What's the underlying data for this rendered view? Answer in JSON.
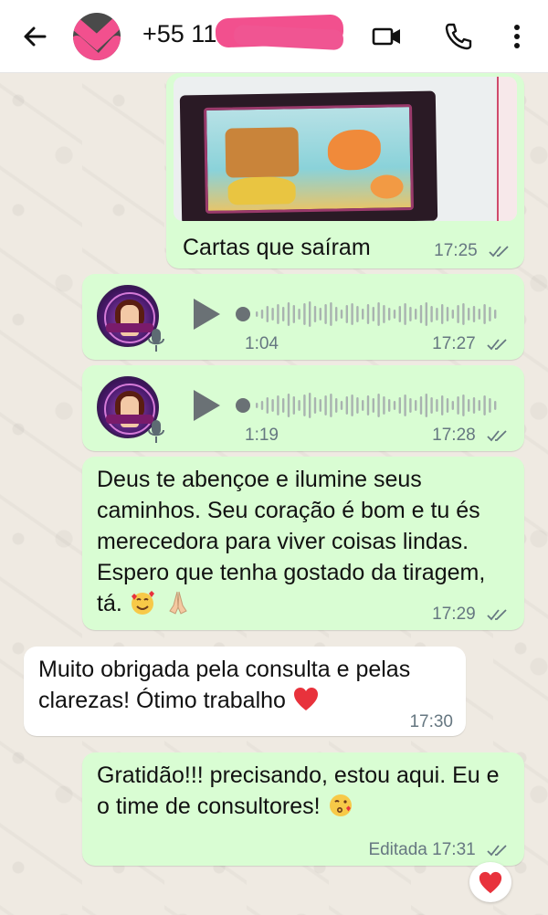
{
  "header": {
    "contact_name": "+55 11 ...",
    "icons": [
      "back-arrow-icon",
      "video-call-icon",
      "phone-icon",
      "more-vert-icon"
    ]
  },
  "messages": {
    "image": {
      "caption": "Cartas que saíram",
      "time": "17:25"
    },
    "voice1": {
      "duration": "1:04",
      "time": "17:27"
    },
    "voice2": {
      "duration": "1:19",
      "time": "17:28"
    },
    "bless": {
      "text": "Deus te abençoe e ilumine seus caminhos. Seu coração é bom e tu és merecedora para viver coisas lindas. Espero que tenha gostado da tiragem, tá.",
      "time": "17:29"
    },
    "thanks": {
      "text": "Muito obrigada pela consulta e pelas clarezas! Ótimo trabalho",
      "time": "17:30"
    },
    "grat": {
      "text": "Gratidão!!! precisando, estou aqui. Eu e o time de consultores!",
      "edited_label": "Editada",
      "time": "17:31"
    }
  },
  "colors": {
    "outgoing_bubble": "#d9fdd3",
    "incoming_bubble": "#ffffff",
    "chat_background": "#efeae2",
    "timestamp": "#667781",
    "redaction": "#f2508e"
  }
}
